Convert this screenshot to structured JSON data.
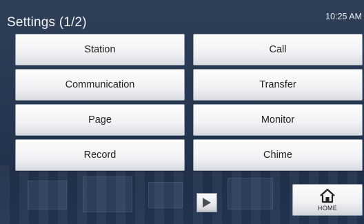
{
  "header": {
    "title": "Settings (1/2)",
    "time": "10:25 AM"
  },
  "menu": {
    "items": [
      {
        "label": "Station"
      },
      {
        "label": "Call"
      },
      {
        "label": "Communication"
      },
      {
        "label": "Transfer"
      },
      {
        "label": "Page"
      },
      {
        "label": "Monitor"
      },
      {
        "label": "Record"
      },
      {
        "label": "Chime"
      }
    ]
  },
  "footer": {
    "next_icon": "play-right-icon",
    "home_icon": "home-icon",
    "home_label": "HOME"
  },
  "colors": {
    "background": "#2a3a52",
    "button_face": "#f1f2f4",
    "button_text": "#1f1f1f",
    "title_text": "#f2f4f8"
  }
}
